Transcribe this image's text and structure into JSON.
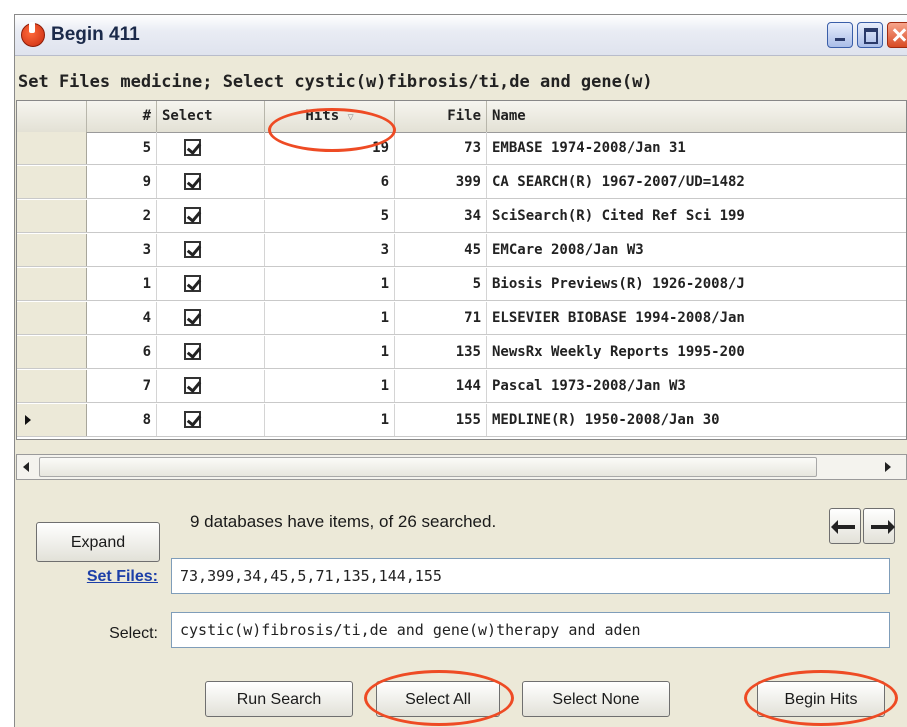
{
  "window": {
    "title": "Begin 411"
  },
  "query_line": "Set Files medicine; Select cystic(w)fibrosis/ti,de and gene(w)",
  "table": {
    "columns": {
      "num": "#",
      "select": "Select",
      "hits": "Hits",
      "file": "File",
      "name": "Name"
    },
    "rows": [
      {
        "num": "5",
        "checked": true,
        "hits": "19",
        "file": "73",
        "name": "EMBASE  1974-2008/Jan 31",
        "current": false
      },
      {
        "num": "9",
        "checked": true,
        "hits": "6",
        "file": "399",
        "name": "CA SEARCH(R)  1967-2007/UD=1482",
        "current": false
      },
      {
        "num": "2",
        "checked": true,
        "hits": "5",
        "file": "34",
        "name": "SciSearch(R) Cited Ref Sci  199",
        "current": false
      },
      {
        "num": "3",
        "checked": true,
        "hits": "3",
        "file": "45",
        "name": "EMCare  2008/Jan W3",
        "current": false
      },
      {
        "num": "1",
        "checked": true,
        "hits": "1",
        "file": "5",
        "name": "Biosis Previews(R)  1926-2008/J",
        "current": false
      },
      {
        "num": "4",
        "checked": true,
        "hits": "1",
        "file": "71",
        "name": "ELSEVIER BIOBASE  1994-2008/Jan",
        "current": false
      },
      {
        "num": "6",
        "checked": true,
        "hits": "1",
        "file": "135",
        "name": "NewsRx Weekly Reports  1995-200",
        "current": false
      },
      {
        "num": "7",
        "checked": true,
        "hits": "1",
        "file": "144",
        "name": "Pascal  1973-2008/Jan W3",
        "current": false
      },
      {
        "num": "8",
        "checked": true,
        "hits": "1",
        "file": "155",
        "name": "MEDLINE(R)  1950-2008/Jan 30",
        "current": true
      }
    ]
  },
  "status_text": "9 databases have items, of 26 searched.",
  "buttons": {
    "expand": "Expand",
    "run_search": "Run Search",
    "select_all": "Select All",
    "select_none": "Select None",
    "begin_hits": "Begin Hits"
  },
  "set_files": {
    "label": "Set Files:",
    "value": "73,399,34,45,5,71,135,144,155"
  },
  "select_field": {
    "label": "Select:",
    "value": "cystic(w)fibrosis/ti,de and gene(w)therapy and aden"
  },
  "colors": {
    "highlight": "#ee4b24",
    "link": "#1c3fa8",
    "window_bg": "#ece9d8"
  }
}
